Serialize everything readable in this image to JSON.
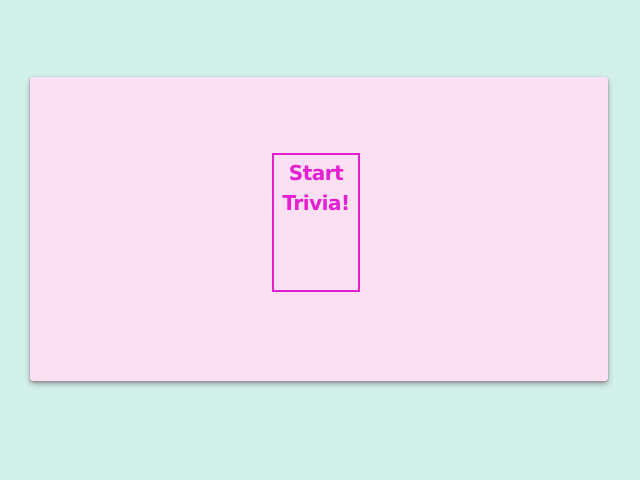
{
  "colors": {
    "background": "#d2f1ea",
    "card": "#fae0f2",
    "accent": "#e61fd2"
  },
  "start_button": {
    "label": "Start Trivia!"
  }
}
